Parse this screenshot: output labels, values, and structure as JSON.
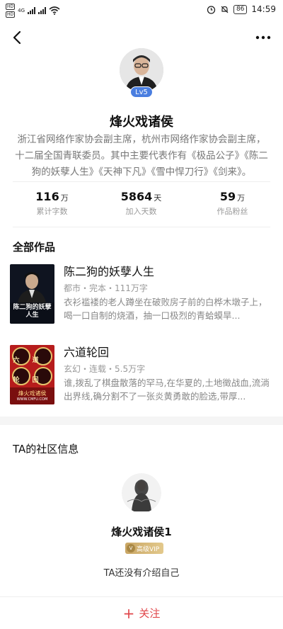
{
  "status_bar": {
    "sim1": "HD",
    "sim2": "HD",
    "network": "4G",
    "battery": "86",
    "time": "14:59"
  },
  "profile": {
    "level": "Lv5",
    "name": "烽火戏诸侯",
    "bio": "浙江省网络作家协会副主席，杭州市网络作家协会副主席，十二届全国青联委员。其中主要代表作有《极品公子》《陈二狗的妖孽人生》《天神下凡》《雪中悍刀行》《剑来》。"
  },
  "stats": [
    {
      "value": "116",
      "unit": "万",
      "label": "累计字数"
    },
    {
      "value": "5864",
      "unit": "天",
      "label": "加入天数"
    },
    {
      "value": "59",
      "unit": "万",
      "label": "作品粉丝"
    }
  ],
  "works": {
    "title": "全部作品",
    "books": [
      {
        "title": "陈二狗的妖孽人生",
        "meta": "都市・完本・111万字",
        "desc": "衣衫褴褛的老人蹲坐在破败房子前的白桦木墩子上，喝一口自制的烧酒，抽一口极烈的青蛤蟆旱...",
        "cover_text": "陈二狗的妖孽人生"
      },
      {
        "title": "六道轮回",
        "meta": "玄幻・连载・5.5万字",
        "desc": "谁,拨乱了棋盘散落的罕马,在华夏的,土地徵战血,流淌出界线,确分割不了一张炎黄勇敢的脸选,带厚...",
        "cover_text": "六道轮回",
        "cover_footer": "烽火戏诸侯",
        "cover_site": "WWW.CMFU.COM"
      }
    ]
  },
  "community": {
    "title": "TA的社区信息",
    "name": "烽火戏诸侯1",
    "vip_label": "高级VIP",
    "intro": "TA还没有介绍自己"
  },
  "follow": {
    "label": "关注"
  },
  "icons": {
    "back": "back-arrow-icon",
    "more": "more-dots-icon",
    "plus": "plus-icon"
  },
  "colors": {
    "accent": "#e0464a",
    "level_badge": "#4a7ee0",
    "vip_gold": "#c9a664"
  }
}
